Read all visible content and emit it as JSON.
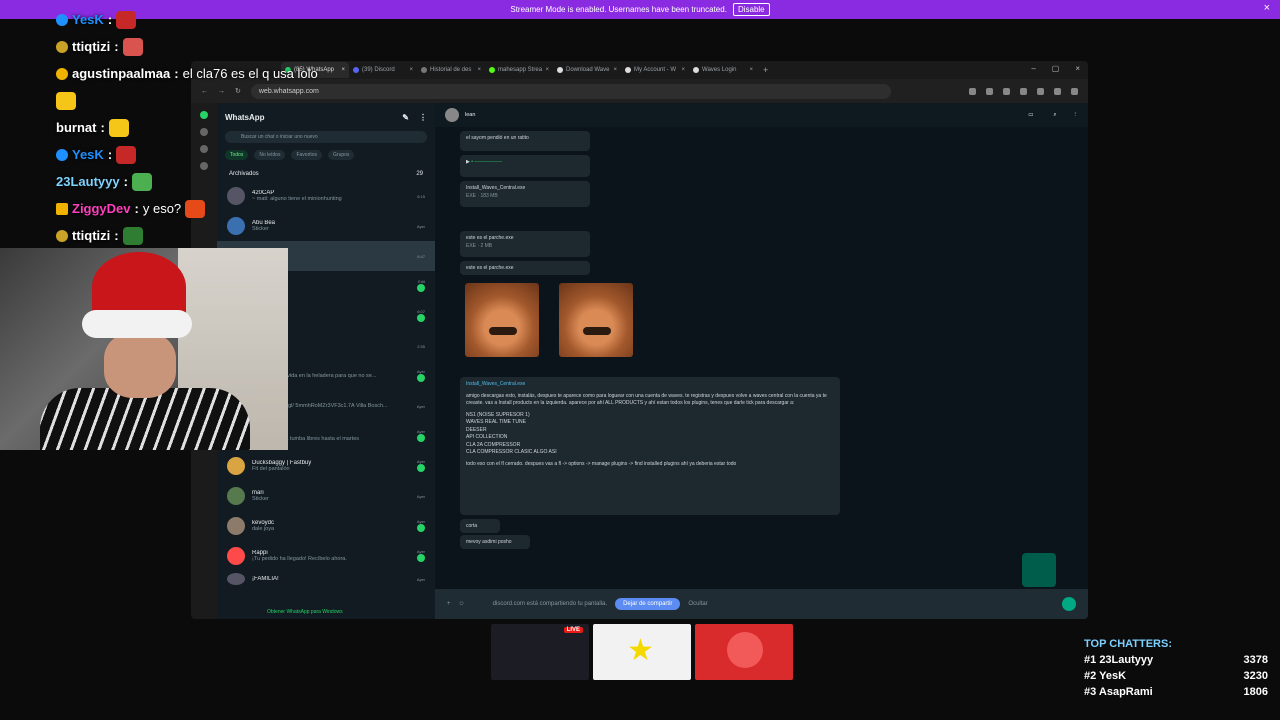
{
  "banner": {
    "text": "Streamer Mode is enabled. Usernames have been truncated.",
    "button": "Disable",
    "close": "×"
  },
  "chat": [
    {
      "user": "YesK",
      "message": "",
      "color": "#1e90ff"
    },
    {
      "user": "ttiqtizi",
      "message": "",
      "color": "#ffffff"
    },
    {
      "user": "agustinpaalmaa",
      "message": "el cla76 es el q usa lolo",
      "color": "#ffffff"
    },
    {
      "user": "",
      "message": "",
      "color": "#ffffff"
    },
    {
      "user": "burnat",
      "message": "",
      "color": "#ffffff"
    },
    {
      "user": "YesK",
      "message": "",
      "color": "#1e90ff"
    },
    {
      "user": "23Lautyyy",
      "message": "",
      "color": "#7fd3ff"
    },
    {
      "user": "ZiggyDev",
      "message": "y eso?",
      "color": "#ff3fbf"
    },
    {
      "user": "ttiqtizi",
      "message": "",
      "color": "#ffffff"
    }
  ],
  "browser": {
    "tabs": [
      "(85) WhatsApp",
      "(39) Discord",
      "Historial de des",
      "mahesapp Strea",
      "Download Wave",
      "My Account - W",
      "Waves Login"
    ],
    "url": "web.whatsapp.com"
  },
  "whatsapp": {
    "title": "WhatsApp",
    "search_placeholder": "Buscar un chat o iniciar uno nuevo",
    "filters": [
      "Todos",
      "No leídos",
      "Favoritos",
      "Grupos"
    ],
    "archived": "Archivados",
    "archived_count": "29",
    "chats": [
      {
        "name": "420CAP",
        "preview": "~ mati: alguno tiene el minionhunting",
        "time": "6:15"
      },
      {
        "name": "Abu Bea",
        "preview": "Sticker",
        "time": "Ayer"
      },
      {
        "name": "",
        "preview": "",
        "time": "6:47"
      },
      {
        "name": "",
        "preview": "",
        "time": "Edit"
      },
      {
        "name": "",
        "preview": "",
        "time": "6:07"
      },
      {
        "name": "",
        "preview": "",
        "time": "2:55"
      },
      {
        "name": "",
        "preview": "a con puré servida en la heladera para que no se...",
        "time": "Ayer"
      },
      {
        "name": "",
        "preview": "lease.app.goo.gl/ 5mmhRoMZr3VF3c1.7A Villa Bosch...",
        "time": "Ayer"
      },
      {
        "name": "an Martín",
        "preview": "Pasa la lengua tumba libres hasta el martes",
        "time": "Ayer"
      },
      {
        "name": "Ducksbaggy | Fastbuy",
        "preview": "Fit del pantalón",
        "time": "Ayer"
      },
      {
        "name": "mari",
        "preview": "Sticker",
        "time": "Ayer"
      },
      {
        "name": "kevoydc",
        "preview": "dale joya",
        "time": "Ayer"
      },
      {
        "name": "Rappi",
        "preview": "¡Tu pedido ha llegado! Recíbelo ahora.",
        "time": "Ayer"
      },
      {
        "name": "¡FAMILIA!",
        "preview": "",
        "time": "Ayer"
      }
    ],
    "get_app": "Obtener WhatsApp para Windows",
    "contact": "lean",
    "messages": {
      "file1": "Install_Waves_Central.exe",
      "file1_meta": "EXE · 183 MB",
      "quote": "el sayom pendió en un ratito",
      "file2": "este es el parche.exe",
      "file2_meta": "EXE · 2 MB",
      "caption": "este es el parche.exe",
      "long_header": "Install_Waves_Central.exe",
      "long_text": "amigo descargas esto, instalás, despues te aparece como para loguear con una cuenta de waves. te registras y despues volve a waves central con la cuenta ya te creaste. vas a Install products en la izquierda. aparece por ahí ALL PRODUCTS y ahí estan todos los plugins, tenes que darle tick para descargar a:",
      "plugin_list": [
        "NS1 (NOISE SUPRESOR 1)",
        "WAVES REAL TIME TUNE",
        "DEESER",
        "API COLLECTION",
        "CLA 2A COMPRESSOR",
        "CLA COMPRESSOR CLASIC ALGO ASI"
      ],
      "outro": "todo eso con el fl cerrado. despues vas a fl -> options -> manage plugins -> find installed plugins ahí ya deberia estar todo",
      "short1": "corta",
      "short2": "mevoy asdimi posho"
    },
    "composer": {
      "sharing": "discord.com está compartiendo tu pantalla.",
      "stop": "Dejar de compartir",
      "hide": "Ocultar"
    }
  },
  "top_chatters": {
    "title": "TOP CHATTERS:",
    "list": [
      {
        "rank": "#1",
        "name": "23Lautyyy",
        "count": "3378"
      },
      {
        "rank": "#2",
        "name": "YesK",
        "count": "3230"
      },
      {
        "rank": "#3",
        "name": "AsapRami",
        "count": "1806"
      }
    ]
  },
  "thumbs": {
    "live": "LIVE"
  },
  "colors": {
    "banner": "#8a2be2",
    "whatsapp_green": "#25d366",
    "share_button": "#5c8cf2",
    "chatters_title": "#7ed0ff"
  }
}
